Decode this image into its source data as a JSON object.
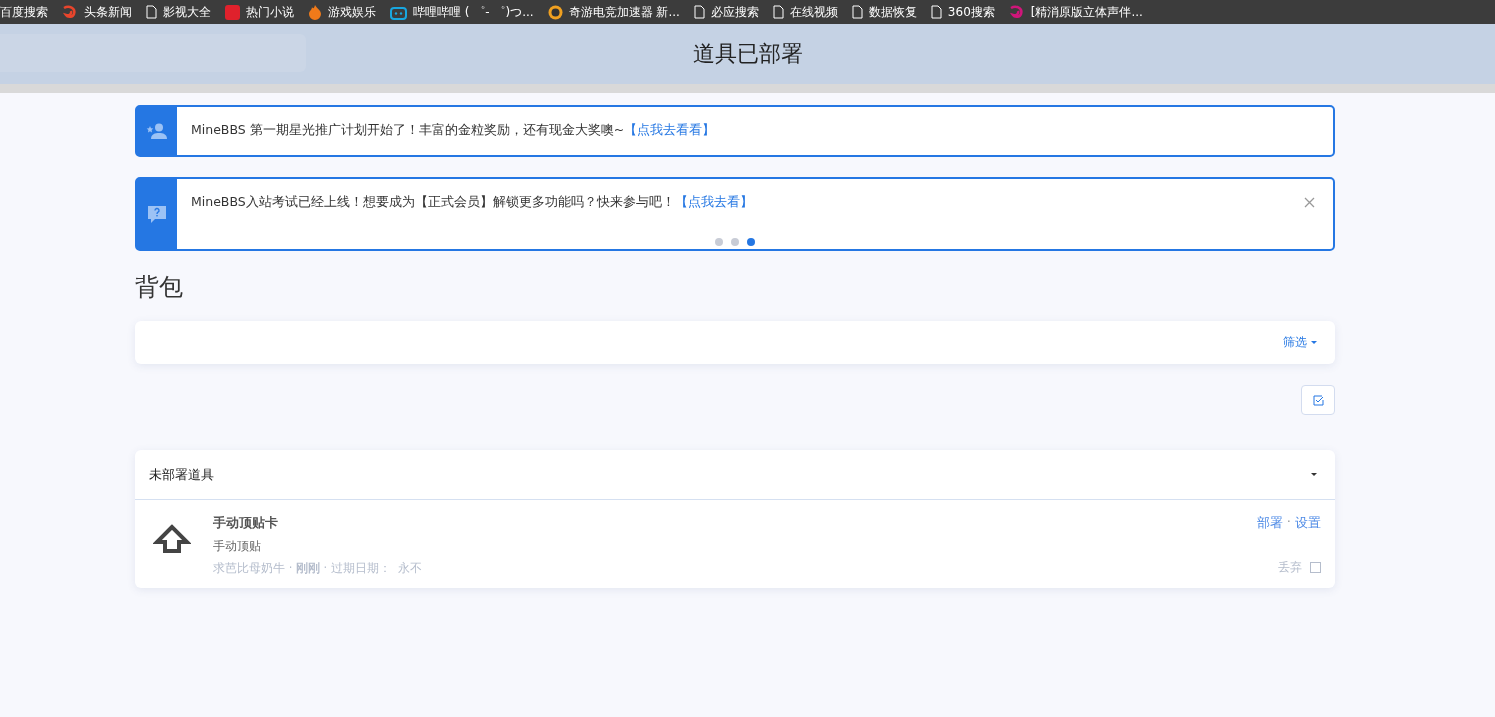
{
  "bookmarks": [
    {
      "label": "百度搜索",
      "kind": "none"
    },
    {
      "label": "头条新闻",
      "kind": "swirl",
      "color": "#e8452c"
    },
    {
      "label": "影视大全",
      "kind": "page"
    },
    {
      "label": "热门小说",
      "kind": "square",
      "color": "#e0212c"
    },
    {
      "label": "游戏娱乐",
      "kind": "flame",
      "color": "#f07a1a"
    },
    {
      "label": "哔哩哔哩 ( ゜- ゜)つ...",
      "kind": "tv",
      "color": "#18a7e0"
    },
    {
      "label": "奇游电竞加速器 新...",
      "kind": "badge",
      "color": "#f0a020"
    },
    {
      "label": "必应搜索",
      "kind": "page"
    },
    {
      "label": "在线视频",
      "kind": "page"
    },
    {
      "label": "数据恢复",
      "kind": "page"
    },
    {
      "label": "360搜索",
      "kind": "page"
    },
    {
      "label": "[精消原版立体声伴...",
      "kind": "swirl",
      "color": "#d0157a"
    }
  ],
  "banner": {
    "title": "道具已部署"
  },
  "notices": [
    {
      "kind": "user",
      "text": "MineBBS 第一期星光推广计划开始了！丰富的金粒奖励，还有现金大奖噢~",
      "link": "【点我去看看】",
      "closable": false
    },
    {
      "kind": "question",
      "text": "MineBBS入站考试已经上线！想要成为【正式会员】解锁更多功能吗？快来参与吧！",
      "link": "【点我去看】",
      "closable": true,
      "dots": [
        {
          "selected": false
        },
        {
          "selected": false
        },
        {
          "selected": true
        }
      ]
    }
  ],
  "section_title": "背包",
  "filter": {
    "label": "筛选"
  },
  "panel": {
    "title": "未部署道具",
    "items": [
      {
        "name": "手动顶贴卡",
        "description": "手动顶贴",
        "meta": "求芭比母奶牛 · **刚刚** · 过期日期：  永不",
        "actions": [
          "部署",
          "设置"
        ],
        "action_separator": "·",
        "discard": "丢弃",
        "checked": false
      }
    ]
  }
}
